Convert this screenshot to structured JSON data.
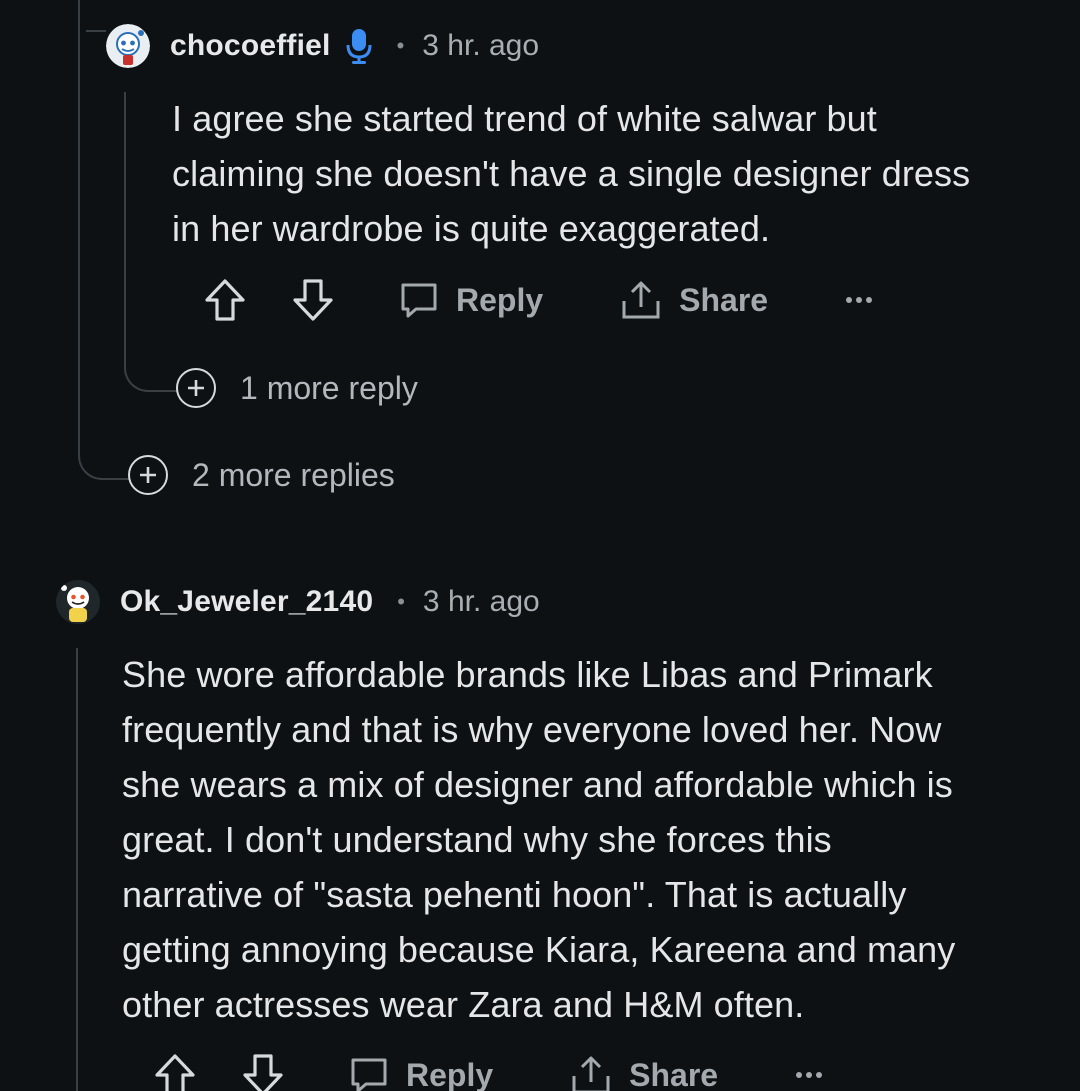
{
  "comment1": {
    "username": "chocoeffiel",
    "time": "3 hr. ago",
    "lines": [
      "I agree she started trend of white salwar but",
      "claiming she doesn't have a single designer dress",
      "in her wardrobe is quite exaggerated."
    ],
    "reply_label": "Reply",
    "share_label": "Share",
    "more_reply_label": "1 more reply"
  },
  "parent_more_replies_label": "2 more replies",
  "comment2": {
    "username": "Ok_Jeweler_2140",
    "time": "3 hr. ago",
    "lines": [
      "She wore affordable brands like Libas and Primark",
      "frequently and that is why everyone loved her. Now",
      "she wears a mix of designer and affordable which is",
      "great. I don't understand why she forces this",
      "narrative of \"sasta pehenti hoon\". That is actually",
      "getting annoying because Kiara, Kareena and many",
      "other actresses wear Zara and H&M often."
    ],
    "reply_label": "Reply",
    "share_label": "Share"
  },
  "icons": {
    "upvote": "arrow-up-outline",
    "downvote": "arrow-down-outline",
    "reply": "speech-bubble",
    "share": "upload-arrow",
    "more": "ellipsis",
    "mic": "microphone",
    "expand": "plus-circle"
  },
  "colors": {
    "background": "#0d1114",
    "text": "#e4e6e8",
    "muted": "#a4a9ad",
    "mic_blue": "#3b8cf3",
    "thread_line": "#3a3f43"
  }
}
